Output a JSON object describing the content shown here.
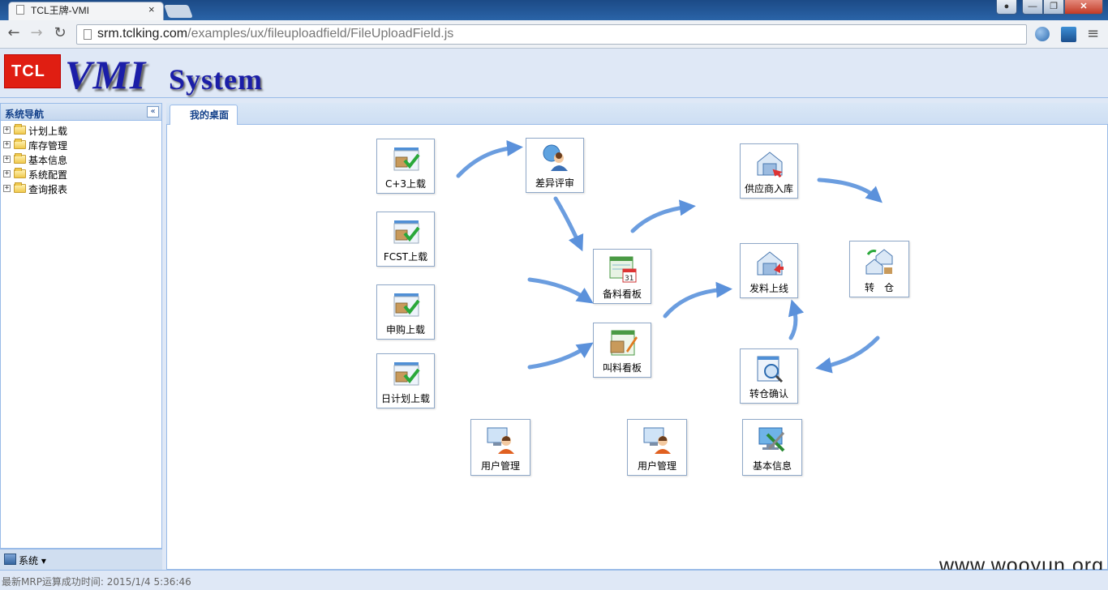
{
  "browser": {
    "tab_title": "TCL王牌-VMI",
    "tab_close": "×",
    "url_host": "srm.tclking.com",
    "url_path": "/examples/ux/fileuploadfield/FileUploadField.js",
    "window_controls": {
      "minimize": "—",
      "maximize": "❐",
      "close": "✕",
      "user": "👤"
    },
    "nav_icons": [
      "back-arrow-icon",
      "forward-arrow-icon",
      "reload-icon"
    ]
  },
  "header": {
    "logo_text": "TCL",
    "title_main": "VMI",
    "title_sub": "System"
  },
  "sidebar": {
    "title": "系统导航",
    "collapse_glyph": "«",
    "items": [
      {
        "label": "计划上载"
      },
      {
        "label": "库存管理"
      },
      {
        "label": "基本信息"
      },
      {
        "label": "系统配置"
      },
      {
        "label": "查询报表"
      }
    ],
    "footer_menu": "系统 ▾"
  },
  "center": {
    "tab_label": "我的桌面",
    "buttons": [
      {
        "label": "C+3上载",
        "icon": "upload-box-check-icon"
      },
      {
        "label": "FCST上载",
        "icon": "upload-box-check-icon"
      },
      {
        "label": "申购上载",
        "icon": "upload-box-check-icon"
      },
      {
        "label": "日计划上载",
        "icon": "upload-box-check-icon"
      },
      {
        "label": "差异评审",
        "icon": "review-user-icon"
      },
      {
        "label": "备料看板",
        "icon": "calendar-board-icon"
      },
      {
        "label": "叫料看板",
        "icon": "call-material-board-icon"
      },
      {
        "label": "供应商入库",
        "icon": "warehouse-in-icon"
      },
      {
        "label": "发料上线",
        "icon": "warehouse-out-icon"
      },
      {
        "label": "转　仓",
        "icon": "warehouse-transfer-icon"
      },
      {
        "label": "转仓确认",
        "icon": "confirm-search-icon"
      },
      {
        "label": "用户管理",
        "icon": "user-admin-icon"
      },
      {
        "label": "用户管理",
        "icon": "user-admin-icon"
      },
      {
        "label": "基本信息",
        "icon": "settings-tools-icon"
      }
    ]
  },
  "watermark": "www.wooyun.org",
  "status_bar": {
    "text": "最新MRP运算成功时间: 2015/1/4 5:36:46"
  },
  "colors": {
    "panel_bg": "#dfe8f6",
    "panel_border": "#99bbe8",
    "header_text": "#15428b",
    "arrow_blue": "#4a86d8",
    "logo_red": "#e01e12",
    "title_blue": "#1b1ea8"
  }
}
